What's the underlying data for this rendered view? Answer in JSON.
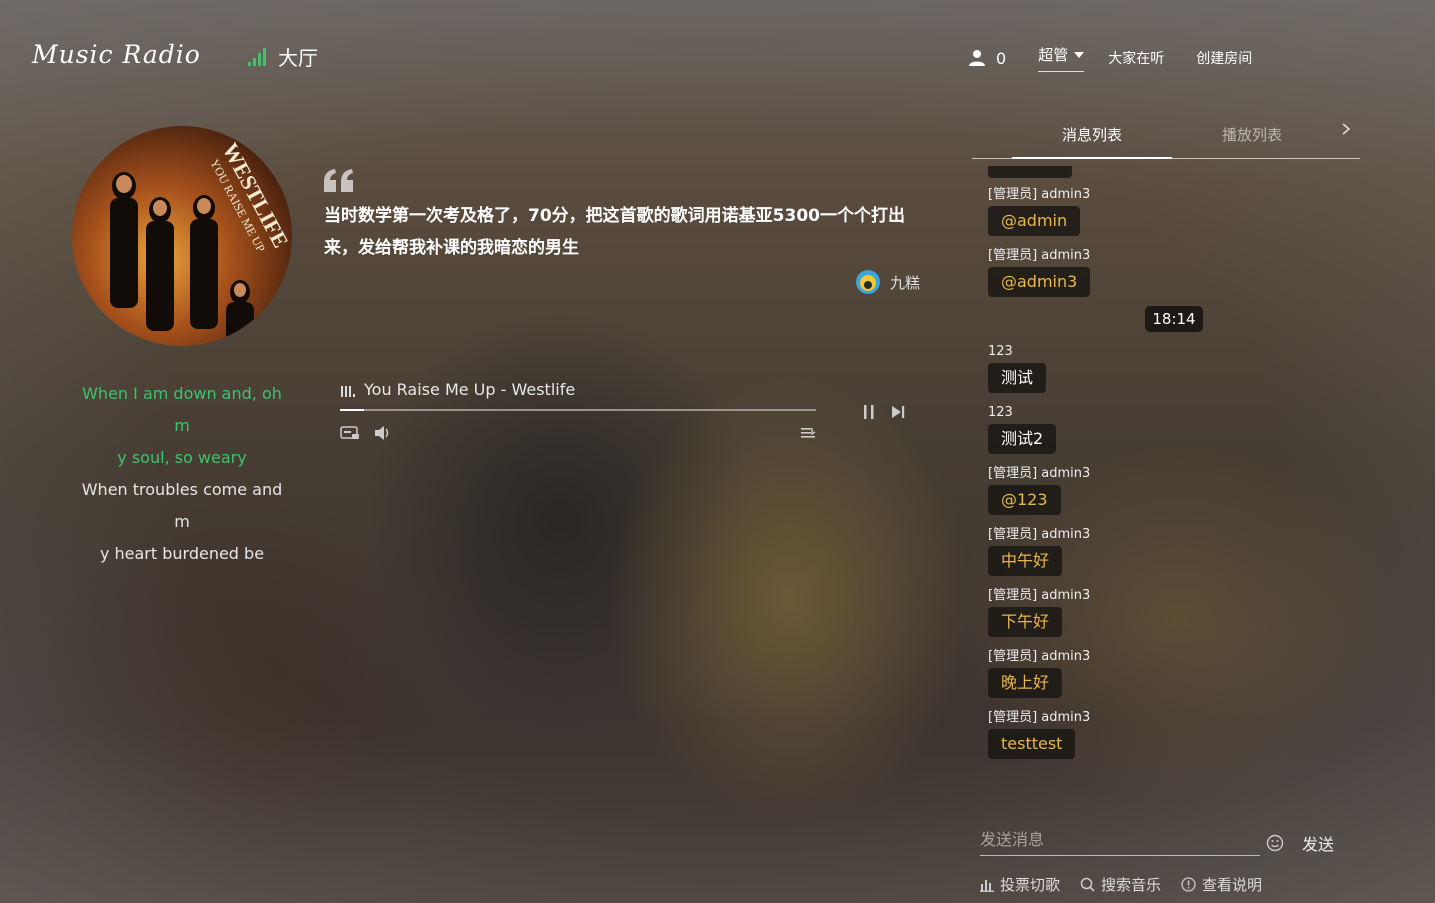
{
  "header": {
    "logo": "Music Radio",
    "room_name": "大厅",
    "online_count": "0",
    "admin_label": "超管",
    "nav_items": [
      "大家在听",
      "创建房间"
    ]
  },
  "quote": {
    "text": "当时数学第一次考及格了，70分，把这首歌的歌词用诺基亚5300一个个打出来，发给帮我补课的我暗恋的男生",
    "author": "九糕"
  },
  "lyrics": {
    "active": [
      "When I am down and, oh m",
      "y soul, so weary"
    ],
    "next": [
      "When troubles come and m",
      "y heart burdened be"
    ]
  },
  "player": {
    "song": "You Raise Me Up - Westlife",
    "progress": 0.05
  },
  "album_art": {
    "title": "WESTLIFE",
    "subtitle": "YOU RAISE ME UP"
  },
  "tabs": {
    "messages": "消息列表",
    "playlist": "播放列表"
  },
  "messages": [
    {
      "type": "msg",
      "user": "[管理员] admin3",
      "text": "@admin",
      "style": "gold"
    },
    {
      "type": "msg",
      "user": "[管理员] admin3",
      "text": "@admin3",
      "style": "gold"
    },
    {
      "type": "time",
      "text": "18:14"
    },
    {
      "type": "msg",
      "user": "123",
      "text": "测试",
      "style": "white"
    },
    {
      "type": "msg",
      "user": "123",
      "text": "测试2",
      "style": "white"
    },
    {
      "type": "msg",
      "user": "[管理员] admin3",
      "text": "@123",
      "style": "gold"
    },
    {
      "type": "msg",
      "user": "[管理员] admin3",
      "text": "中午好",
      "style": "gold"
    },
    {
      "type": "msg",
      "user": "[管理员] admin3",
      "text": "下午好",
      "style": "gold"
    },
    {
      "type": "msg",
      "user": "[管理员] admin3",
      "text": "晚上好",
      "style": "gold"
    },
    {
      "type": "msg",
      "user": "[管理员] admin3",
      "text": "testtest",
      "style": "gold"
    }
  ],
  "input": {
    "placeholder": "发送消息",
    "send_label": "发送"
  },
  "bottom_tools": [
    {
      "icon": "vote-chart-icon",
      "label": "投票切歌"
    },
    {
      "icon": "search-icon",
      "label": "搜索音乐"
    },
    {
      "icon": "info-icon",
      "label": "查看说明"
    }
  ],
  "colors": {
    "accent_green": "#3cc46c",
    "gold": "#e8b84a"
  }
}
